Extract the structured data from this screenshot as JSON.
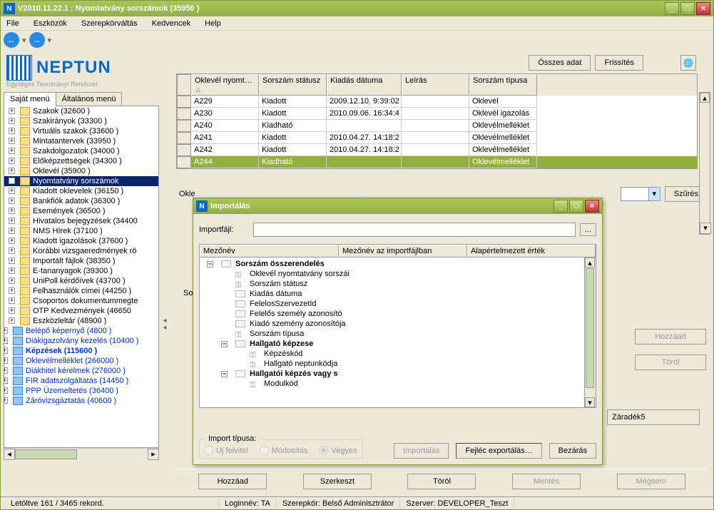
{
  "window": {
    "title": "V2010.11.22.1 : Nyomtatvány sorszámok (35950  )"
  },
  "menu": [
    "File",
    "Eszközök",
    "Szerepkörváltás",
    "Kedvencek",
    "Help"
  ],
  "logo": {
    "main": "NEPTUN",
    "sub": "Egységes Tanulmányi Rendszer"
  },
  "tabs": {
    "self": "Saját menü",
    "general": "Általános menü"
  },
  "tree": [
    "Szakok (32600  )",
    "Szakirányok (33300  )",
    "Virtuális szakok (33600  )",
    "Mintatantervek (33950  )",
    "Szakdolgozatok (34000  )",
    "Előképzettségek (34300  )",
    "Oklevél (35900  )",
    "Nyomtatvány sorszámok",
    "Kiadott oklevelek (36150  )",
    "Bankfiók adatok (36300  )",
    "Események (36500  )",
    "Hivatalos bejegyzések (34400",
    "NMS Hírek (37100  )",
    "Kiadott igazolások (37600  )",
    "Korábbi vizsgaeredmények rö",
    "Importált fájlok (38350  )",
    "E-tananyagok (39300  )",
    "UniPoll kérdőívek (43700  )",
    "Felhasználók címei (44250  )",
    "Csoportos dokumentummegte",
    "OTP Kedvezmények (46650",
    "Eszközleltár (48900  )"
  ],
  "tree_blue": [
    "Belépő képernyő (4800  )",
    "Diákigazolvány kezelés (10400  )",
    "Képzések (115600  )",
    "Oklevélmelléklet (266000  )",
    "Diákhitel kérelmek (276000  )",
    "FIR adatszolgáltatás (14450  )",
    "PPP Üzemeltetés (36400  )",
    "Záróvizsgáztatás (40600  )"
  ],
  "top_btns": {
    "all": "Összes adat",
    "refresh": "Frissítés"
  },
  "grid": {
    "headers": [
      "Oklevél nyomt…",
      "Sorszám státusz",
      "Kiadás dátuma",
      "Leírás",
      "Sorszám típusa"
    ],
    "rows": [
      [
        "A229",
        "Kiadott",
        "2009.12.10. 9:39:02",
        "",
        "Oklevél"
      ],
      [
        "A230",
        "Kiadott",
        "2010.09.06. 16:34:4",
        "",
        "Oklevél igazolás"
      ],
      [
        "A240",
        "Kiadható",
        "",
        "",
        "Oklevélmelléklet"
      ],
      [
        "A241",
        "Kiadott",
        "2010.04.27. 14:18:2",
        "",
        "Oklevélmelléklet"
      ],
      [
        "A242",
        "Kiadott",
        "2010.04.27. 14:18:2",
        "",
        "Oklevélmelléklet"
      ],
      [
        "A244",
        "Kiadható",
        "",
        "",
        "Oklevélmelléklet"
      ]
    ]
  },
  "filter_btn": "Szűrés",
  "dialog": {
    "title": "Importálás",
    "import_label": "Importfájl:",
    "browse": "...",
    "headers": [
      "Mezőnév",
      "Mezőnév az importfájlban",
      "Alapértelmezett érték"
    ],
    "fields_root": "Sorszám összerendelés",
    "fields": [
      "Oklevél nyomtatvány sorszái",
      "Sorszám státusz",
      "Kiadás dátuma",
      "FelelosSzervezetId",
      "Felelős személy azonosító",
      "Kiadó szemény azonosítója",
      "Sorszám típusa"
    ],
    "fields_sub1": "Hallgató képzese",
    "fields_sub1_children": [
      "Képzéskód",
      "Hallgató neptunkódja"
    ],
    "fields_sub2": "Hallgatói képzés vagy s",
    "fields_sub2_children": [
      "Modulkód"
    ],
    "radio_legend": "Import típusa:",
    "radio_new": "Új felvitel",
    "radio_mod": "Módosítás",
    "radio_mix": "Vegyes",
    "btn_import": "Importálás",
    "btn_export": "Fejléc exportálás…",
    "btn_close": "Bezárás"
  },
  "side": {
    "add": "Hozzáad",
    "del": "Töröl",
    "zaradek": "Záradék5",
    "okle": "Okle",
    "so": "So"
  },
  "bottom": {
    "add": "Hozzáad",
    "edit": "Szerkeszt",
    "del": "Töröl",
    "save": "Mentés",
    "cancel": "Mégsem"
  },
  "status": {
    "left": "Letöltve 161 / 3465 rekord.",
    "login": "Loginnév: TA",
    "role": "Szerepkör: Belső Adminisztrátor",
    "server": "Szerver: DEVELOPER_Teszt"
  }
}
